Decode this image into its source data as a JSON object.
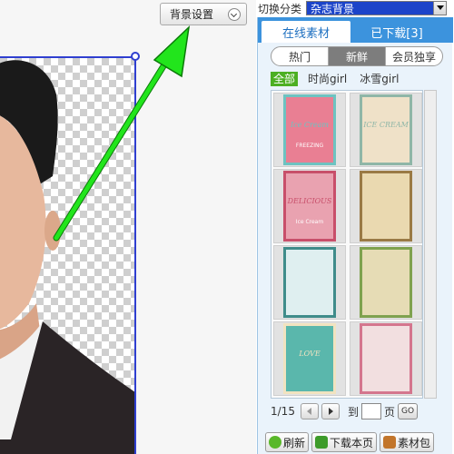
{
  "canvas": {
    "bg_button_label": "背景设置"
  },
  "category": {
    "label": "切换分类",
    "selected": "杂志背景"
  },
  "tabs": [
    {
      "label": "在线素材",
      "active": true
    },
    {
      "label": "已下载[3]",
      "active": false
    }
  ],
  "sort": [
    {
      "label": "热门",
      "active": false
    },
    {
      "label": "新鲜",
      "active": true
    },
    {
      "label": "会员独享",
      "active": false
    }
  ],
  "filters": [
    {
      "label": "全部",
      "active": true
    },
    {
      "label": "时尚girl",
      "active": false
    },
    {
      "label": "冰雪girl",
      "active": false
    }
  ],
  "thumbnails": [
    {
      "name": "ice-cream-pink-poster",
      "text": "Ice Cream",
      "subtext": "FREEZING",
      "bg": "#e97f93",
      "accent": "#6dc3c1"
    },
    {
      "name": "ice-cream-vintage-poster",
      "text": "ICE CREAM",
      "subtext": "",
      "bg": "#efe1c8",
      "accent": "#8fb6a7"
    },
    {
      "name": "delicious-ice-cream-poster",
      "text": "DELICIOUS",
      "subtext": "Ice Cream",
      "bg": "#e9a2b0",
      "accent": "#c84f6a"
    },
    {
      "name": "vintage-paper-frame",
      "text": "",
      "subtext": "",
      "bg": "#ead9b0",
      "accent": "#9a7a45"
    },
    {
      "name": "teal-floral-frame",
      "text": "",
      "subtext": "",
      "bg": "#dfeff0",
      "accent": "#3f8c8a"
    },
    {
      "name": "oval-floral-frame",
      "text": "",
      "subtext": "",
      "bg": "#e6dcb5",
      "accent": "#7fa24f"
    },
    {
      "name": "love-teal-frame",
      "text": "LOVE",
      "subtext": "",
      "bg": "#5ab7ac",
      "accent": "#f1e3c0"
    },
    {
      "name": "pink-rose-frame",
      "text": "",
      "subtext": "",
      "bg": "#f2dfe0",
      "accent": "#d4768e"
    }
  ],
  "pager": {
    "indicator": "1/15",
    "to_label": "到",
    "page_label": "页",
    "go_label": "GO",
    "input_value": ""
  },
  "bottom": {
    "refresh_label": "刷新",
    "download_label": "下载本页",
    "package_label": "素材包"
  },
  "colors": {
    "tab_bar": "#3c93dd",
    "selection_border": "#2f3fd0",
    "arrow": "#22e51c",
    "filter_active": "#4caf22"
  }
}
